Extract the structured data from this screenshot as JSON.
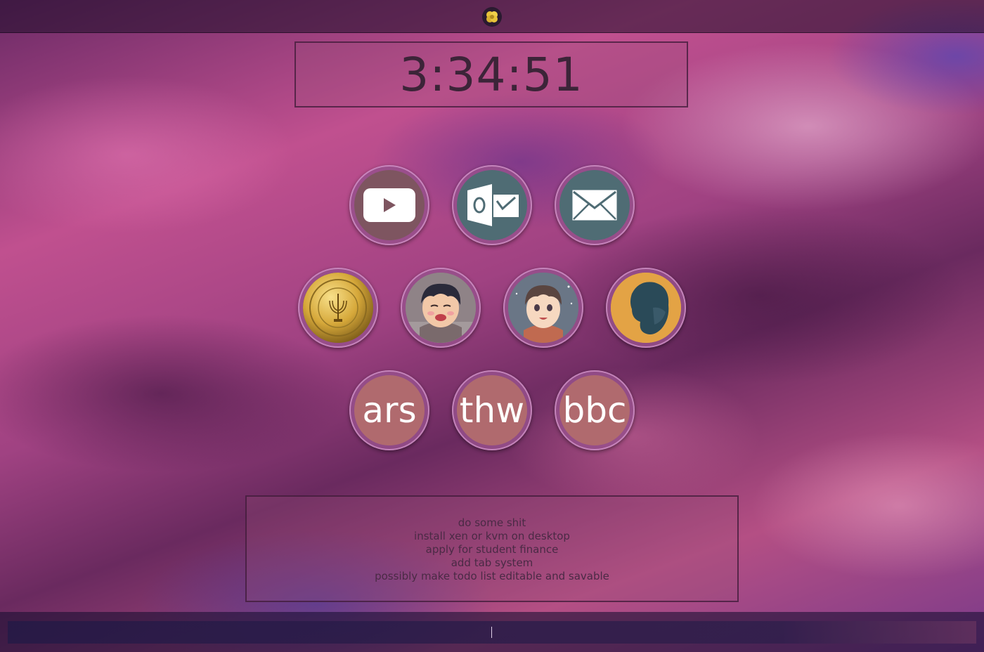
{
  "topbar": {
    "logo_icon": "yellow-flower-icon"
  },
  "clock": {
    "time": "3:34:51"
  },
  "shortcuts": {
    "row1": [
      {
        "name": "youtube",
        "icon": "youtube-icon"
      },
      {
        "name": "outlook",
        "icon": "outlook-icon"
      },
      {
        "name": "mail",
        "icon": "envelope-icon"
      }
    ],
    "row2": [
      {
        "name": "gold-coin",
        "icon": "gold-coin-icon"
      },
      {
        "name": "avatar-1",
        "icon": "anime-avatar-icon"
      },
      {
        "name": "avatar-2",
        "icon": "anime-avatar-icon"
      },
      {
        "name": "avatar-3",
        "icon": "silhouette-avatar-icon"
      }
    ],
    "row3": [
      {
        "name": "ars",
        "label": "ars"
      },
      {
        "name": "thw",
        "label": "thw"
      },
      {
        "name": "bbc",
        "label": "bbc"
      }
    ]
  },
  "todo": {
    "items": [
      "do some shit",
      "install xen or kvm on desktop",
      "apply for student finance",
      "add tab system",
      "possibly make todo list editable and savable"
    ]
  },
  "command_bar": {
    "value": ""
  },
  "colors": {
    "tile_ring": "#9a5090",
    "tile_teal": "#4f6c74",
    "tile_rose": "#b06a6e",
    "clock_text": "#3c2438"
  }
}
